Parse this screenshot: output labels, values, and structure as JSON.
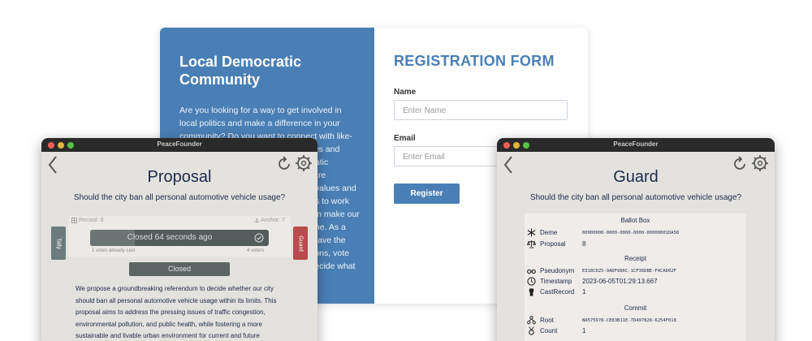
{
  "registration": {
    "title": "Local Democratic Community",
    "body": "Are you looking for a way to get involved in local politics and make a difference in your community? Do you want to connect with like-minded people who share your values and beliefs? If so, join our Local Democratic Community, a group of people who are committed to promoting democratic values and empowering our local neighborhoods to work together. By working together, we can make our community a better place for everyone. As a member of our community, you will have the opportunity to participate in discussions, vote on meaningful proposals and help decide what matters most to",
    "form_title": "REGISTRATION FORM",
    "name_label": "Name",
    "name_placeholder": "Enter Name",
    "email_label": "Email",
    "email_placeholder": "Enter Email",
    "register_button": "Register"
  },
  "proposal_window": {
    "window_title": "PeaceFounder",
    "heading": "Proposal",
    "question": "Should the city ban all personal automotive vehicle usage?",
    "record": "Record: 8",
    "anchor": "Anchor: 7",
    "status_text": "Closed 64 seconds ago",
    "progress": 0.25,
    "votes_cast": "1 votes already cast",
    "voters": "4 voters",
    "tally_label": "Tally",
    "guard_label": "Guard",
    "closed_button": "Closed",
    "description": "We propose a groundbreaking referendum to decide whether our city should ban all personal automotive vehicle usage within its limits. This proposal aims to address the pressing issues of traffic congestion, environmental pollution, and public health, while fostering a more sustainable and livable urban environment for current and future"
  },
  "guard_window": {
    "window_title": "PeaceFounder",
    "heading": "Guard",
    "question": "Should the city ban all personal automotive vehicle usage?",
    "ballot_box": {
      "title": "Ballot Box",
      "deme_label": "Deme",
      "deme_value": "00000000-0000-0000-0000-00000001DA58",
      "proposal_label": "Proposal",
      "proposal_value": "8"
    },
    "receipt": {
      "title": "Receipt",
      "pseudonym_label": "Pseudonym",
      "pseudonym_value": "E318CD25-9ADF986C-1CF36DBE-F4CAD02F",
      "timestamp_label": "Timestamp",
      "timestamp_value": "2023-06-05T01:29:13.667",
      "castrecord_label": "CastRecord",
      "castrecord_value": "1"
    },
    "commit": {
      "title": "Commit",
      "root_label": "Root",
      "root_value": "BA575978-CE83B11E-7D497828-6254F018",
      "count_label": "Count",
      "count_value": "1"
    }
  },
  "colors": {
    "brand_blue": "#4a7fb5",
    "window_bg": "#e4e2de",
    "tally_button": "#6c7b7b",
    "guard_button": "#b84b4b",
    "text_navy": "#1b2a48"
  },
  "icons": [
    "back-chevron-icon",
    "reload-icon",
    "gear-icon",
    "checkmark-circle-icon",
    "anchor-icon",
    "record-icon",
    "snowflake-icon",
    "scales-icon",
    "glasses-icon",
    "clock-icon",
    "fist-icon",
    "tree-icon",
    "medal-icon"
  ]
}
